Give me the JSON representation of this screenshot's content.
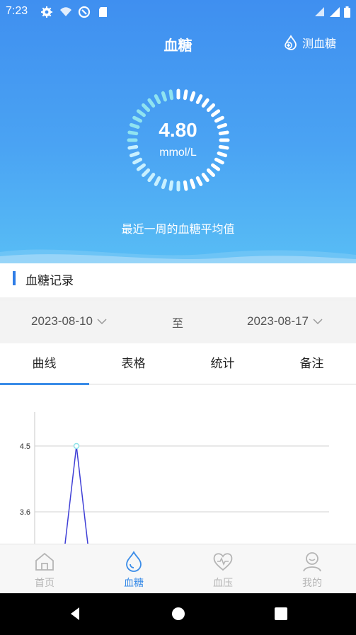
{
  "status_bar": {
    "time": "7:23",
    "icons": [
      "gear-icon",
      "wifi-icon",
      "vpn-icon",
      "sd-card-icon",
      "signal-icon",
      "battery-icon"
    ]
  },
  "header": {
    "title": "血糖",
    "measure_button": "测血糖",
    "measure_icon": "drop-plus-icon"
  },
  "summary": {
    "value": "4.80",
    "unit": "mmol/L",
    "caption": "最近一周的血糖平均值"
  },
  "section": {
    "title": "血糖记录"
  },
  "date_range": {
    "start": "2023-08-10",
    "separator": "至",
    "end": "2023-08-17"
  },
  "tabs": [
    {
      "label": "曲线",
      "active": true
    },
    {
      "label": "表格",
      "active": false
    },
    {
      "label": "统计",
      "active": false
    },
    {
      "label": "备注",
      "active": false
    }
  ],
  "chart_data": {
    "type": "line",
    "y_ticks": [
      "4.5",
      "3.6"
    ],
    "series": [
      {
        "values": [
          3.0,
          4.5,
          3.0
        ]
      }
    ],
    "colors": {
      "line": "#3f3fd6",
      "point": "#8fe3e8",
      "grid": "#d0d0d0"
    }
  },
  "bottom_nav": [
    {
      "label": "首页",
      "icon": "home-icon",
      "active": false
    },
    {
      "label": "血糖",
      "icon": "drop-icon",
      "active": true
    },
    {
      "label": "血压",
      "icon": "heart-pulse-icon",
      "active": false
    },
    {
      "label": "我的",
      "icon": "user-icon",
      "active": false
    }
  ],
  "colors": {
    "accent": "#3a8ce8",
    "hero_top": "#3f8ff0",
    "hero_bottom": "#58bdf5",
    "inactive_nav": "#b5b5b5"
  }
}
